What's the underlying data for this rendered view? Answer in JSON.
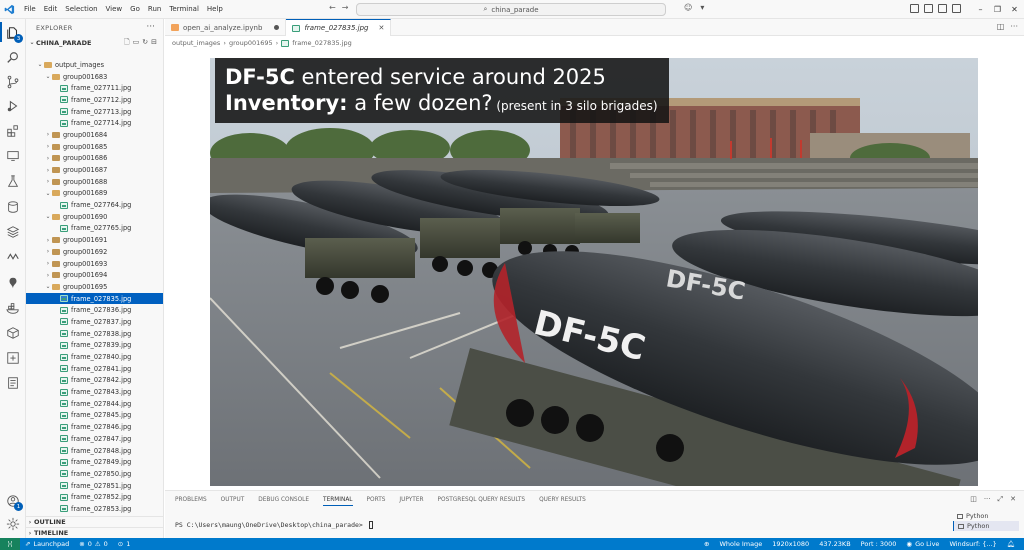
{
  "menu": [
    "File",
    "Edit",
    "Selection",
    "View",
    "Go",
    "Run",
    "Terminal",
    "Help"
  ],
  "search": {
    "text": "china_parade"
  },
  "sidebar": {
    "title": "EXPLORER",
    "root": "CHINA_PARADE",
    "tree": [
      {
        "label": "output_images",
        "type": "folder-open",
        "indent": 1
      },
      {
        "label": "group001683",
        "type": "folder-open",
        "indent": 2
      },
      {
        "label": "frame_027711.jpg",
        "type": "file",
        "indent": 3
      },
      {
        "label": "frame_027712.jpg",
        "type": "file",
        "indent": 3
      },
      {
        "label": "frame_027713.jpg",
        "type": "file",
        "indent": 3
      },
      {
        "label": "frame_027714.jpg",
        "type": "file",
        "indent": 3
      },
      {
        "label": "group001684",
        "type": "folder",
        "indent": 2
      },
      {
        "label": "group001685",
        "type": "folder",
        "indent": 2
      },
      {
        "label": "group001686",
        "type": "folder",
        "indent": 2
      },
      {
        "label": "group001687",
        "type": "folder",
        "indent": 2
      },
      {
        "label": "group001688",
        "type": "folder",
        "indent": 2
      },
      {
        "label": "group001689",
        "type": "folder-open",
        "indent": 2
      },
      {
        "label": "frame_027764.jpg",
        "type": "file",
        "indent": 3
      },
      {
        "label": "group001690",
        "type": "folder-open",
        "indent": 2
      },
      {
        "label": "frame_027765.jpg",
        "type": "file",
        "indent": 3
      },
      {
        "label": "group001691",
        "type": "folder",
        "indent": 2
      },
      {
        "label": "group001692",
        "type": "folder",
        "indent": 2
      },
      {
        "label": "group001693",
        "type": "folder",
        "indent": 2
      },
      {
        "label": "group001694",
        "type": "folder",
        "indent": 2
      },
      {
        "label": "group001695",
        "type": "folder-open",
        "indent": 2
      },
      {
        "label": "frame_027835.jpg",
        "type": "file",
        "indent": 3,
        "selected": true
      },
      {
        "label": "frame_027836.jpg",
        "type": "file",
        "indent": 3
      },
      {
        "label": "frame_027837.jpg",
        "type": "file",
        "indent": 3
      },
      {
        "label": "frame_027838.jpg",
        "type": "file",
        "indent": 3
      },
      {
        "label": "frame_027839.jpg",
        "type": "file",
        "indent": 3
      },
      {
        "label": "frame_027840.jpg",
        "type": "file",
        "indent": 3
      },
      {
        "label": "frame_027841.jpg",
        "type": "file",
        "indent": 3
      },
      {
        "label": "frame_027842.jpg",
        "type": "file",
        "indent": 3
      },
      {
        "label": "frame_027843.jpg",
        "type": "file",
        "indent": 3
      },
      {
        "label": "frame_027844.jpg",
        "type": "file",
        "indent": 3
      },
      {
        "label": "frame_027845.jpg",
        "type": "file",
        "indent": 3
      },
      {
        "label": "frame_027846.jpg",
        "type": "file",
        "indent": 3
      },
      {
        "label": "frame_027847.jpg",
        "type": "file",
        "indent": 3
      },
      {
        "label": "frame_027848.jpg",
        "type": "file",
        "indent": 3
      },
      {
        "label": "frame_027849.jpg",
        "type": "file",
        "indent": 3
      },
      {
        "label": "frame_027850.jpg",
        "type": "file",
        "indent": 3
      },
      {
        "label": "frame_027851.jpg",
        "type": "file",
        "indent": 3
      },
      {
        "label": "frame_027852.jpg",
        "type": "file",
        "indent": 3
      },
      {
        "label": "frame_027853.jpg",
        "type": "file",
        "indent": 3
      },
      {
        "label": "frame_027854.jpg",
        "type": "file",
        "indent": 3
      }
    ],
    "outline": "OUTLINE",
    "timeline": "TIMELINE"
  },
  "tabs": [
    {
      "label": "open_ai_analyze.ipynb",
      "kind": "notebook",
      "modified": true
    },
    {
      "label": "frame_027835.jpg",
      "kind": "image",
      "active": true
    }
  ],
  "breadcrumb": [
    "output_images",
    "group001695",
    "frame_027835.jpg"
  ],
  "image": {
    "caption_line1_bold": "DF-5C",
    "caption_line1_rest": " entered service around 2025",
    "caption_line2_bold": "Inventory:",
    "caption_line2_rest": " a few dozen?",
    "caption_line2_small": " (present in 3 silo brigades)",
    "missile_label": "DF-5C"
  },
  "panel": {
    "tabs": [
      "PROBLEMS",
      "OUTPUT",
      "DEBUG CONSOLE",
      "TERMINAL",
      "PORTS",
      "JUPYTER",
      "POSTGRESQL QUERY RESULTS",
      "QUERY RESULTS"
    ],
    "active_tab": "TERMINAL",
    "prompt": "PS C:\\Users\\maung\\OneDrive\\Desktop\\china_parade> ",
    "terminals": [
      "Python",
      "Python"
    ]
  },
  "statusbar": {
    "launchpad": "Launchpad",
    "errors": "0",
    "warnings": "0",
    "ports": "1",
    "zoom_mode": "Whole Image",
    "dimensions": "1920x1080",
    "filesize": "437.23KB",
    "port": "Port : 3000",
    "golive": "Go Live",
    "windsurf": "Windsurf: {...}"
  },
  "colors": {
    "accent": "#005fb8",
    "statusbar": "#007acc",
    "selection": "#0060c0"
  }
}
